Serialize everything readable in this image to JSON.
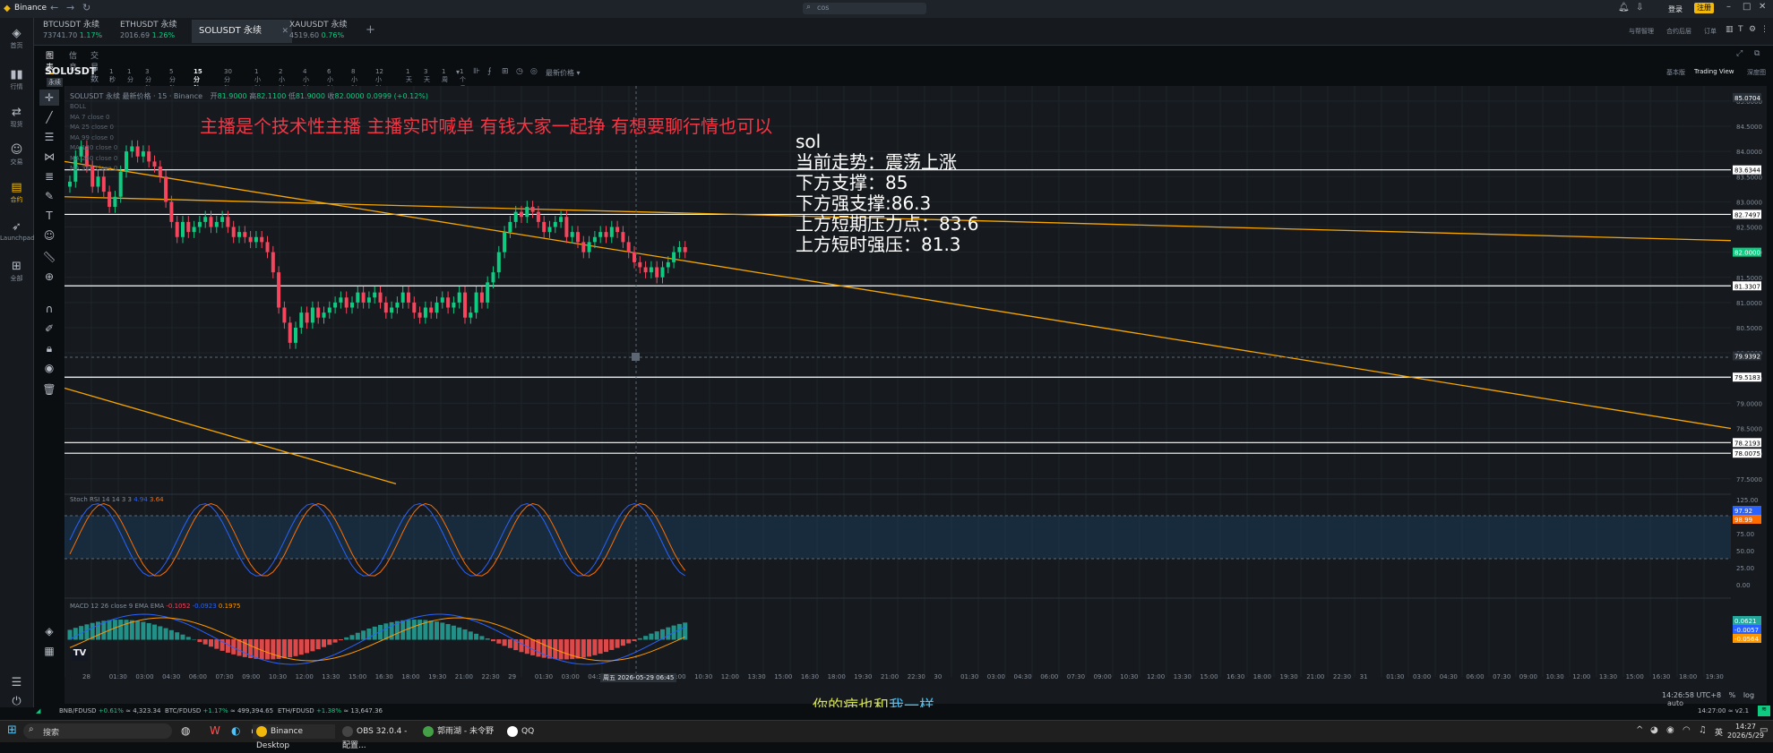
{
  "window": {
    "app_name": "Binance",
    "search_placeholder": "cos"
  },
  "titlebar_right": {
    "login": "登录",
    "register": "注册"
  },
  "top_right_links": [
    "与帮智理",
    "合约后层",
    "订单"
  ],
  "tabs": [
    {
      "symbol": "BTCUSDT 永续",
      "price": "73741.70",
      "change": "1.17%"
    },
    {
      "symbol": "ETHUSDT 永续",
      "price": "2016.69",
      "change": "1.26%"
    },
    {
      "symbol": "SOLUSDT 永续",
      "price": "",
      "change": ""
    },
    {
      "symbol": "XAUUSDT 永续",
      "price": "4519.60",
      "change": "0.76%"
    }
  ],
  "tab_add": "+",
  "leftnav": [
    {
      "icon": "binance-logo-icon",
      "label": "首页"
    },
    {
      "icon": "chart-bars-icon",
      "label": "行情"
    },
    {
      "icon": "exchange-icon",
      "label": "现货"
    },
    {
      "icon": "robot-icon",
      "label": "交易"
    },
    {
      "icon": "contract-icon",
      "label": "合约"
    },
    {
      "icon": "rocket-icon",
      "label": "Launchpad"
    },
    {
      "icon": "grid-icon",
      "label": "全部"
    }
  ],
  "subtabs": [
    "图表",
    "信息",
    "交易数据"
  ],
  "symbol": {
    "name": "SOLUSDT",
    "type": "永续"
  },
  "intervals": [
    "1秒",
    "1分",
    "3分钟",
    "5分钟",
    "15分钟",
    "30分钟",
    "1小时",
    "2小时",
    "4小时",
    "6小时",
    "8小时",
    "12小时",
    "1天",
    "3天",
    "1周",
    "1个月"
  ],
  "active_interval": "15分钟",
  "price_type": "最新价格",
  "view_modes": {
    "basic": "基本版",
    "tradingview": "Trading View",
    "depth": "深度图"
  },
  "ohlc_line": {
    "title": "SOLUSDT 永续 最新价格 · 15 · Binance",
    "o_label": "开",
    "o": "81.9000",
    "h_label": "高",
    "h": "82.1100",
    "l_label": "低",
    "l": "81.9000",
    "c_label": "收",
    "c": "82.0000",
    "chg": "0.0999 (+0.12%)"
  },
  "indicators": [
    "BOLL",
    "MA 7 close 0",
    "MA 25 close 0",
    "MA 99 close 0",
    "MA 120 close 0",
    "MA 240 close 0",
    "MA 360 close 0"
  ],
  "overlay": {
    "banner": "主播是个技术性主播 主播实时喊单 有钱大家一起挣 有想要聊行情也可以",
    "lines": [
      "sol",
      "当前走势：震荡上涨",
      "下方支撑：85",
      "下方强支撑:86.3",
      "上方短期压力点：83.6",
      "上方短时强压：81.3"
    ]
  },
  "price_axis": [
    "85.0000",
    "84.5000",
    "84.0000",
    "83.5000",
    "83.0000",
    "82.5000",
    "82.0000",
    "81.5000",
    "81.0000",
    "80.5000",
    "80.0000",
    "79.5000",
    "79.0000",
    "78.5000",
    "78.0000",
    "77.5000"
  ],
  "price_tags": [
    {
      "label": "85.0704",
      "color": "#ffffff",
      "bg": "#2b3139"
    },
    {
      "label": "83.6344",
      "color": "#000000",
      "bg": "#ffffff"
    },
    {
      "label": "82.7497",
      "color": "#000000",
      "bg": "#ffffff"
    },
    {
      "label": "82.0000",
      "color": "#ffffff",
      "bg": "#0ecb81"
    },
    {
      "label": "81.3307",
      "color": "#000000",
      "bg": "#ffffff"
    },
    {
      "label": "79.9392",
      "color": "#ffffff",
      "bg": "#2b3139"
    },
    {
      "label": "79.5183",
      "color": "#000000",
      "bg": "#ffffff"
    },
    {
      "label": "78.2193",
      "color": "#000000",
      "bg": "#ffffff"
    },
    {
      "label": "78.0075",
      "color": "#000000",
      "bg": "#ffffff"
    }
  ],
  "stoch_rsi": {
    "label": "Stoch RSI 14 14 3 3",
    "k": "4.94",
    "d": "3.64",
    "axis": [
      "125.00",
      "100.00",
      "75.00",
      "50.00",
      "25.00",
      "0.00"
    ],
    "tags": [
      "97.92",
      "98.99"
    ]
  },
  "macd": {
    "label": "MACD 12 26 close 9 EMA EMA",
    "hist": "-0.1052",
    "macd_v": "-0.0923",
    "signal": "0.1975",
    "tags": [
      "0.0621",
      "-0.0057",
      "-0.0564"
    ]
  },
  "time_axis": [
    "28",
    "01:30",
    "03:00",
    "04:30",
    "06:00",
    "07:30",
    "09:00",
    "10:30",
    "12:00",
    "13:30",
    "15:00",
    "16:30",
    "18:00",
    "19:30",
    "21:00",
    "22:30",
    "29",
    "01:30",
    "03:00",
    "04:30",
    "06:00",
    "07:30",
    "09:00",
    "10:30",
    "12:00",
    "13:30",
    "15:00",
    "16:30",
    "18:00",
    "19:30",
    "21:00",
    "22:30",
    "30",
    "01:30",
    "03:00",
    "04:30",
    "06:00",
    "07:30",
    "09:00",
    "10:30",
    "12:00",
    "13:30",
    "15:00",
    "16:30",
    "18:00",
    "19:30",
    "21:00",
    "22:30",
    "31",
    "01:30",
    "03:00",
    "04:30",
    "06:00",
    "07:30",
    "09:00",
    "10:30",
    "12:00",
    "13:30",
    "15:00",
    "16:30",
    "18:00",
    "19:30"
  ],
  "crosshair_time": "周五 2026-05-29  06:45",
  "chart_footer": {
    "clock": "14:26:58 UTC+8",
    "pct": "%",
    "log": "log",
    "auto": "auto"
  },
  "subtitle": {
    "part1": "你的病也和",
    "part2": "我一样"
  },
  "statusbar": [
    {
      "pair": "BNB/FDUSD",
      "chg": "+0.61%",
      "price": "≈ 4,323.34"
    },
    {
      "pair": "BTC/FDUSD",
      "chg": "+1.17%",
      "price": "≈ 499,394.65"
    },
    {
      "pair": "ETH/FDUSD",
      "chg": "+1.38%",
      "price": "≈ 13,647.36"
    }
  ],
  "statusbar_right": "14:27:00 ≈ v2.1",
  "taskbar": {
    "search": "搜索",
    "apps": [
      "Binance Desktop",
      "OBS 32.0.4 - 配置...",
      "郭雨湖 - 未令野",
      "QQ"
    ],
    "time": "14:27",
    "date": "2026/5/29",
    "ime": "英"
  },
  "colors": {
    "up": "#0ecb81",
    "down": "#f6465d",
    "accent": "#f0b90b",
    "trendline": "#f7a600",
    "bg": "#161a1e"
  },
  "chart_data": {
    "type": "candlestick",
    "interval": "15m",
    "ylim": [
      77.3,
      85.3
    ],
    "candles_close": [
      83.4,
      83.9,
      84.1,
      83.7,
      83.3,
      83.5,
      83.2,
      82.9,
      83.1,
      83.6,
      84.0,
      84.1,
      83.9,
      84.0,
      83.8,
      83.7,
      83.5,
      83.0,
      82.6,
      82.3,
      82.6,
      82.4,
      82.5,
      82.6,
      82.7,
      82.5,
      82.6,
      82.7,
      82.5,
      82.3,
      82.4,
      82.3,
      82.2,
      82.3,
      82.2,
      82.0,
      81.6,
      80.9,
      80.6,
      80.2,
      80.5,
      80.8,
      80.6,
      80.9,
      80.7,
      80.8,
      80.9,
      81.0,
      81.1,
      80.9,
      81.0,
      81.2,
      81.0,
      81.1,
      81.2,
      81.0,
      80.8,
      80.9,
      81.0,
      81.2,
      81.0,
      80.8,
      80.7,
      80.9,
      80.8,
      81.0,
      81.1,
      80.9,
      81.0,
      81.2,
      80.7,
      80.8,
      81.2,
      81.0,
      81.4,
      81.6,
      82.0,
      82.4,
      82.6,
      82.8,
      82.7,
      82.9,
      82.8,
      82.6,
      82.4,
      82.5,
      82.6,
      82.7,
      82.3,
      82.4,
      82.2,
      82.0,
      82.2,
      82.3,
      82.4,
      82.3,
      82.5,
      82.4,
      82.2,
      82.0,
      81.8,
      81.7,
      81.6,
      81.7,
      81.5,
      81.7,
      81.8,
      82.0,
      82.1,
      82.0
    ]
  }
}
